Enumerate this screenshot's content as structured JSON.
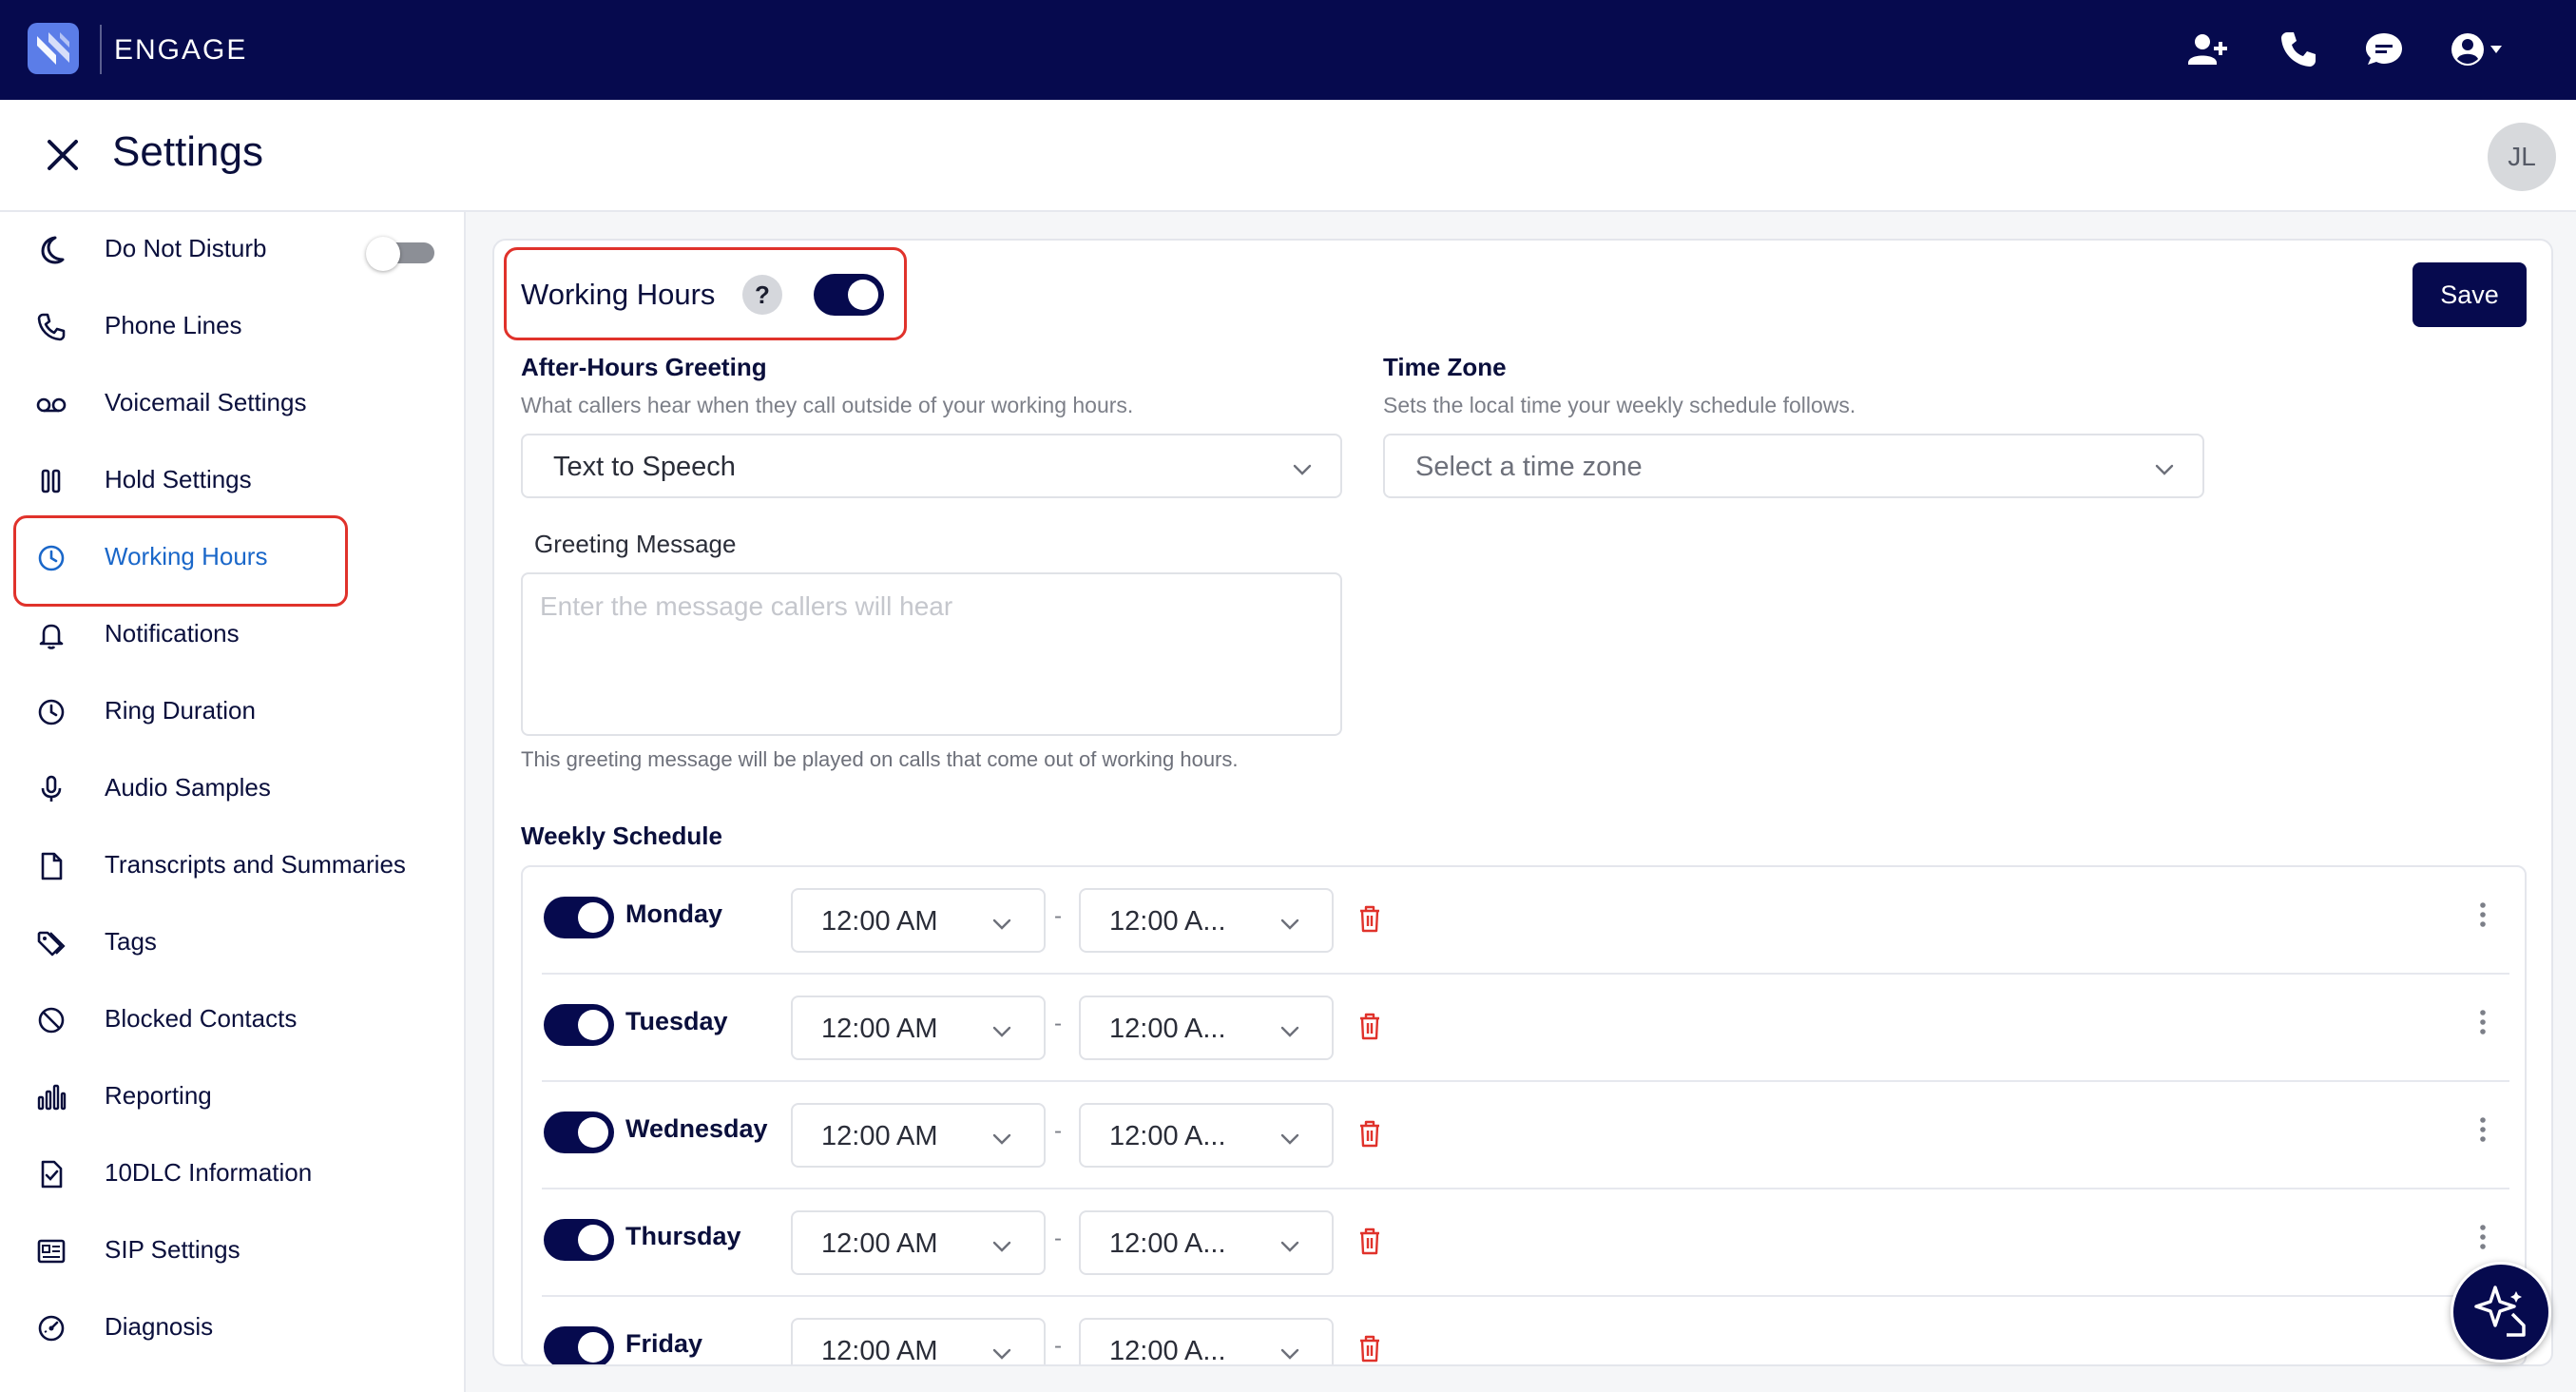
{
  "app": {
    "brand": "ENGAGE"
  },
  "topbar": {
    "icons": [
      "add-user-icon",
      "phone-icon",
      "chat-icon",
      "account-icon"
    ]
  },
  "header": {
    "title": "Settings",
    "avatar_initials": "JL"
  },
  "sidebar": {
    "items": [
      {
        "label": "Do Not Disturb",
        "icon": "moon-icon",
        "toggle_on": false
      },
      {
        "label": "Phone Lines",
        "icon": "phone-icon"
      },
      {
        "label": "Voicemail Settings",
        "icon": "voicemail-icon"
      },
      {
        "label": "Hold Settings",
        "icon": "pause-icon"
      },
      {
        "label": "Working Hours",
        "icon": "clock-icon",
        "active": true
      },
      {
        "label": "Notifications",
        "icon": "bell-icon"
      },
      {
        "label": "Ring Duration",
        "icon": "clock-icon"
      },
      {
        "label": "Audio Samples",
        "icon": "microphone-icon"
      },
      {
        "label": "Transcripts and Summaries",
        "icon": "document-icon"
      },
      {
        "label": "Tags",
        "icon": "tag-icon"
      },
      {
        "label": "Blocked Contacts",
        "icon": "blocked-icon"
      },
      {
        "label": "Reporting",
        "icon": "bar-chart-icon"
      },
      {
        "label": "10DLC Information",
        "icon": "document-check-icon"
      },
      {
        "label": "SIP Settings",
        "icon": "sip-icon"
      },
      {
        "label": "Diagnosis",
        "icon": "gauge-icon"
      }
    ]
  },
  "main": {
    "title": "Working Hours",
    "help": "?",
    "enabled": true,
    "save_label": "Save",
    "greeting": {
      "label": "After-Hours Greeting",
      "description": "What callers hear when they call outside of your working hours.",
      "value": "Text to Speech"
    },
    "timezone": {
      "label": "Time Zone",
      "description": "Sets the local time your weekly schedule follows.",
      "placeholder": "Select a time zone"
    },
    "message": {
      "label": "Greeting Message",
      "placeholder": "Enter the message callers will hear",
      "hint": "This greeting message will be played on calls that come out of working hours."
    },
    "schedule": {
      "label": "Weekly Schedule",
      "separator": "-",
      "days": [
        {
          "name": "Monday",
          "enabled": true,
          "start": "12:00 AM",
          "end": "12:00 A..."
        },
        {
          "name": "Tuesday",
          "enabled": true,
          "start": "12:00 AM",
          "end": "12:00 A..."
        },
        {
          "name": "Wednesday",
          "enabled": true,
          "start": "12:00 AM",
          "end": "12:00 A..."
        },
        {
          "name": "Thursday",
          "enabled": true,
          "start": "12:00 AM",
          "end": "12:00 A..."
        },
        {
          "name": "Friday",
          "enabled": true,
          "start": "12:00 AM",
          "end": "12:00 A..."
        }
      ]
    }
  },
  "colors": {
    "navy": "#060a4e",
    "active_link": "#1a67c9",
    "highlight": "#e0322b",
    "danger": "#e0322b"
  }
}
